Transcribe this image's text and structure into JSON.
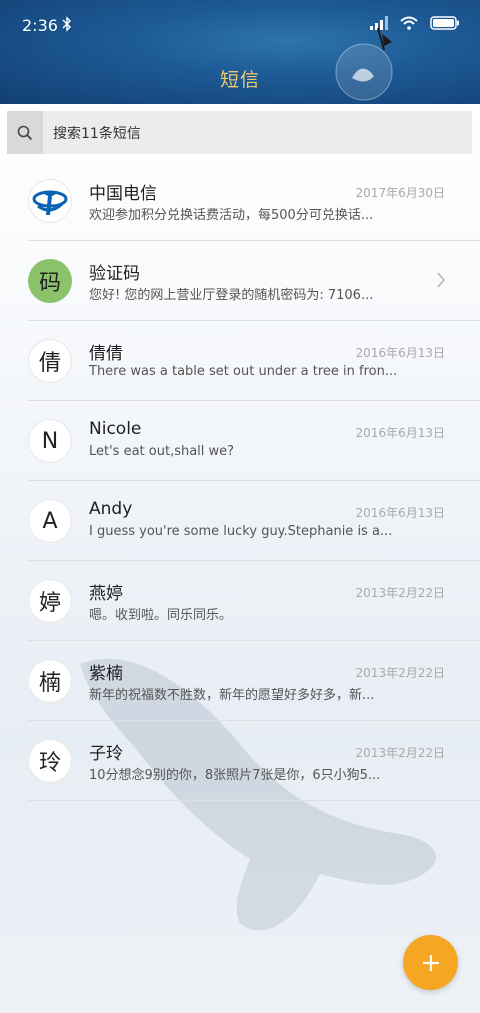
{
  "status_bar": {
    "time": "2:36",
    "bluetooth_icon": "bluetooth-icon",
    "signal_icon": "signal-icon",
    "wifi_icon": "wifi-icon",
    "battery_icon": "battery-icon"
  },
  "header": {
    "title": "短信"
  },
  "search": {
    "placeholder": "搜索11条短信",
    "icon": "search-icon"
  },
  "colors": {
    "title": "#f1c96b",
    "fab": "#f5a623",
    "avatar_green": "#8bc36a"
  },
  "threads": [
    {
      "name": "中国电信",
      "snippet": "欢迎参加积分兑换话费活动，每500分可兑换话...",
      "date": "2017年6月30日",
      "avatar": "",
      "avatar_type": "logo"
    },
    {
      "name": "验证码",
      "snippet": "您好! 您的网上营业厅登录的随机密码为: 7106...",
      "date": "",
      "avatar": "码",
      "avatar_type": "green"
    },
    {
      "name": "倩倩",
      "snippet": "There was a table set out under a tree in fron...",
      "date": "2016年6月13日",
      "avatar": "倩",
      "avatar_type": "white"
    },
    {
      "name": "Nicole",
      "snippet": "Let's eat out,shall we?",
      "date": "2016年6月13日",
      "avatar": "N",
      "avatar_type": "white"
    },
    {
      "name": "Andy",
      "snippet": "I guess you're some lucky guy.Stephanie is a...",
      "date": "2016年6月13日",
      "avatar": "A",
      "avatar_type": "white"
    },
    {
      "name": "燕婷",
      "snippet": "嗯。收到啦。同乐同乐。",
      "date": "2013年2月22日",
      "avatar": "婷",
      "avatar_type": "white"
    },
    {
      "name": "紫楠",
      "snippet": "新年的祝福数不胜数，新年的愿望好多好多，新...",
      "date": "2013年2月22日",
      "avatar": "楠",
      "avatar_type": "white"
    },
    {
      "name": "子玲",
      "snippet": "10分想念9别的你，8张照片7张是你，6只小狗5...",
      "date": "2013年2月22日",
      "avatar": "玲",
      "avatar_type": "white"
    }
  ],
  "fab": {
    "icon": "plus-icon"
  }
}
